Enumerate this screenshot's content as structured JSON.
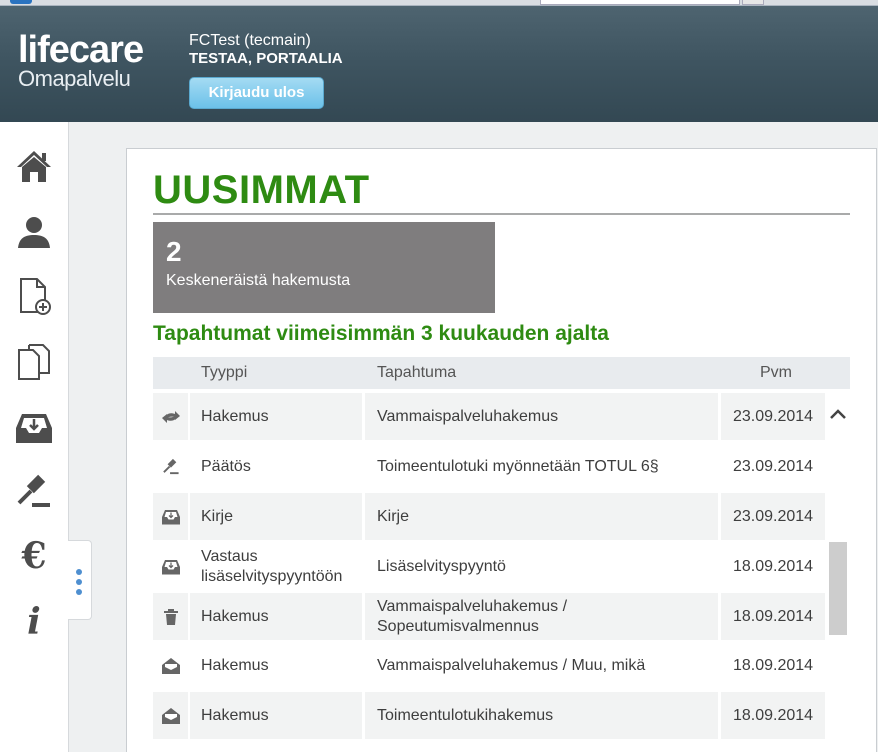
{
  "header": {
    "logo_top": "lifecare",
    "logo_bottom": "Omapalvelu",
    "user_name": "FCTest (tecmain)",
    "user_org": "TESTAA, PORTAALIA",
    "logout_label": "Kirjaudu ulos"
  },
  "sidebar": {
    "items": [
      {
        "icon": "home-icon"
      },
      {
        "icon": "user-icon"
      },
      {
        "icon": "new-document-icon"
      },
      {
        "icon": "documents-icon"
      },
      {
        "icon": "inbox-icon"
      },
      {
        "icon": "gavel-icon"
      },
      {
        "icon": "euro-icon",
        "glyph": "€"
      },
      {
        "icon": "info-icon",
        "glyph": "i"
      }
    ]
  },
  "main": {
    "title": "UUSIMMAT",
    "tile": {
      "count": "2",
      "label": "Keskeneräistä hakemusta"
    },
    "events_title": "Tapahtumat viimeisimmän 3 kuukauden ajalta",
    "columns": {
      "type": "Tyyppi",
      "event": "Tapahtuma",
      "date": "Pvm"
    },
    "rows": [
      {
        "icon": "exchange-icon",
        "type": "Hakemus",
        "event": "Vammaispalveluhakemus",
        "date": "23.09.2014"
      },
      {
        "icon": "gavel-icon",
        "type": "Päätös",
        "event": "Toimeentulotuki myönnetään TOTUL 6§",
        "date": "23.09.2014"
      },
      {
        "icon": "inbox-icon",
        "type": "Kirje",
        "event": "Kirje",
        "date": "23.09.2014"
      },
      {
        "icon": "inbox-icon",
        "type": "Vastaus lisäselvityspyyntöön",
        "event": "Lisäselvityspyyntö",
        "date": "18.09.2014"
      },
      {
        "icon": "trash-icon",
        "type": "Hakemus",
        "event": "Vammaispalveluhakemus / Sopeutumisvalmennus",
        "date": "18.09.2014"
      },
      {
        "icon": "envelope-open-icon",
        "type": "Hakemus",
        "event": "Vammaispalveluhakemus / Muu, mikä",
        "date": "18.09.2014"
      },
      {
        "icon": "envelope-open-icon",
        "type": "Hakemus",
        "event": "Toimeentulotukihakemus",
        "date": "18.09.2014"
      }
    ]
  },
  "colors": {
    "accent_green": "#2e8b12",
    "header_bg": "#3f5561",
    "logout_button": "#6cc1e9",
    "tile_bg": "#7f7d7e"
  }
}
